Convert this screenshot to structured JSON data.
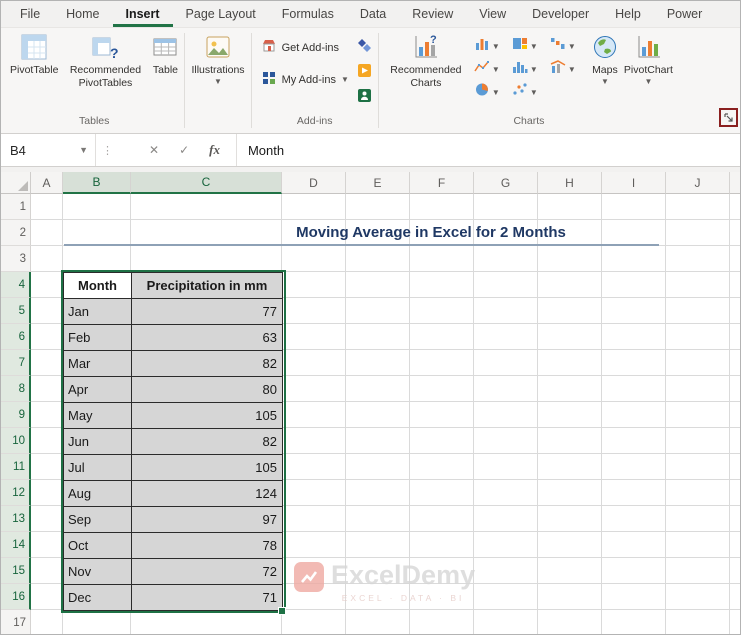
{
  "ribbon": {
    "tabs": [
      "File",
      "Home",
      "Insert",
      "Page Layout",
      "Formulas",
      "Data",
      "Review",
      "View",
      "Developer",
      "Help",
      "Power"
    ],
    "active_tab": "Insert",
    "tables_group": {
      "label": "Tables",
      "pivottable": "PivotTable",
      "recommended_pivottables": "Recommended PivotTables",
      "table": "Table"
    },
    "illustrations_group": {
      "illustrations": "Illustrations"
    },
    "addins_group": {
      "label": "Add-ins",
      "get_addins": "Get Add-ins",
      "my_addins": "My Add-ins"
    },
    "charts_group": {
      "label": "Charts",
      "recommended_charts": "Recommended Charts",
      "maps": "Maps",
      "pivotchart": "PivotChart"
    }
  },
  "formula_bar": {
    "name_box": "B4",
    "fx_label": "fx",
    "content": "Month"
  },
  "sheet": {
    "columns": [
      "A",
      "B",
      "C",
      "D",
      "E",
      "F",
      "G",
      "H",
      "I",
      "J"
    ],
    "selected_columns": [
      "B",
      "C"
    ],
    "rows": 17,
    "selected_rows_start": 4,
    "selected_rows_end": 16,
    "title": "Moving Average in Excel for 2 Months"
  },
  "table": {
    "headers": [
      "Month",
      "Precipitation in mm"
    ],
    "rows": [
      {
        "month": "Jan",
        "value": "77"
      },
      {
        "month": "Feb",
        "value": "63"
      },
      {
        "month": "Mar",
        "value": "82"
      },
      {
        "month": "Apr",
        "value": "80"
      },
      {
        "month": "May",
        "value": "105"
      },
      {
        "month": "Jun",
        "value": "82"
      },
      {
        "month": "Jul",
        "value": "105"
      },
      {
        "month": "Aug",
        "value": "124"
      },
      {
        "month": "Sep",
        "value": "97"
      },
      {
        "month": "Oct",
        "value": "78"
      },
      {
        "month": "Nov",
        "value": "72"
      },
      {
        "month": "Dec",
        "value": "71"
      }
    ]
  },
  "watermark": {
    "brand": "ExcelDemy",
    "tagline": "EXCEL · DATA · BI"
  },
  "colors": {
    "accent_green": "#217346",
    "title_blue": "#1F3864",
    "selection_fill": "#d6d6d6",
    "highlight_red": "#8a1f1f"
  }
}
